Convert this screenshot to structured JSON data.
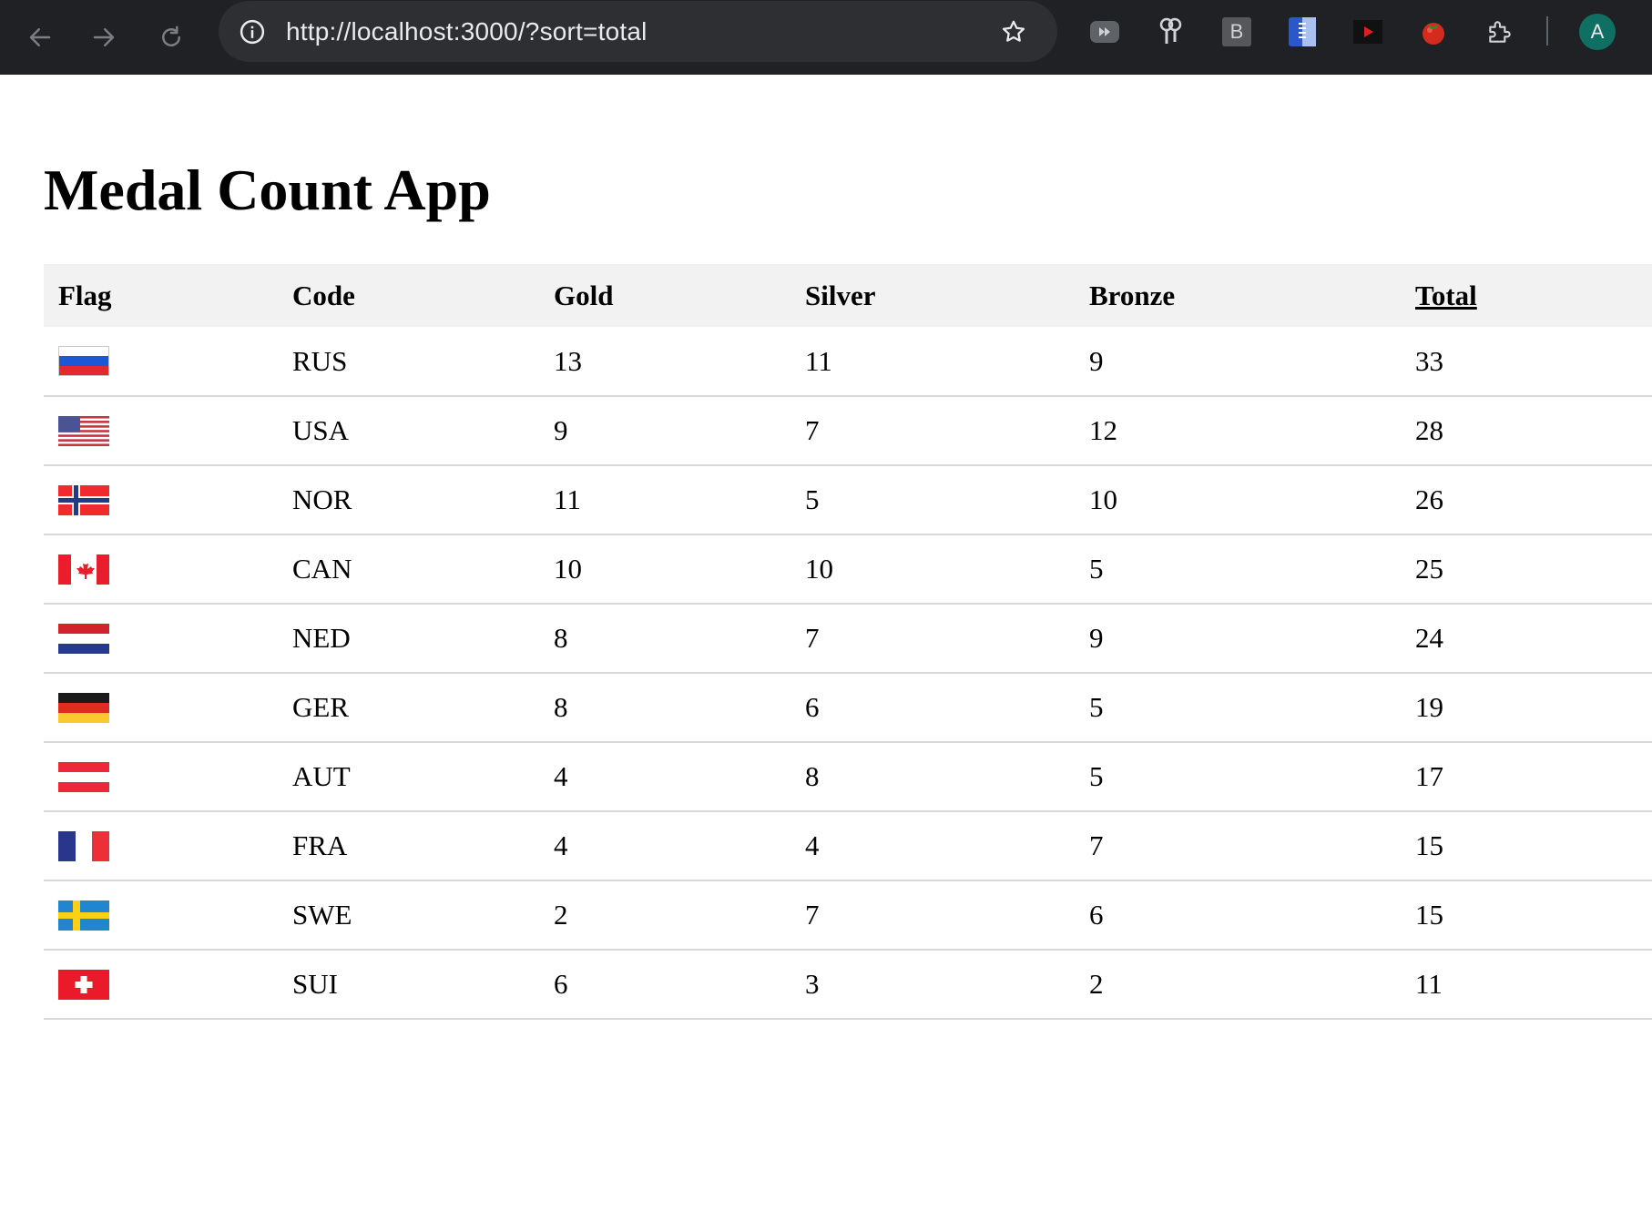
{
  "browser": {
    "url": "http://localhost:3000/?sort=total",
    "extension_letter": "B",
    "profile_initial": "A"
  },
  "page": {
    "title": "Medal Count App"
  },
  "table": {
    "headers": {
      "flag": "Flag",
      "code": "Code",
      "gold": "Gold",
      "silver": "Silver",
      "bronze": "Bronze",
      "total": "Total"
    },
    "sorted_by": "total",
    "rows": [
      {
        "code": "RUS",
        "gold": "13",
        "silver": "11",
        "bronze": "9",
        "total": "33",
        "flag": "russia-flag-icon"
      },
      {
        "code": "USA",
        "gold": "9",
        "silver": "7",
        "bronze": "12",
        "total": "28",
        "flag": "usa-flag-icon"
      },
      {
        "code": "NOR",
        "gold": "11",
        "silver": "5",
        "bronze": "10",
        "total": "26",
        "flag": "norway-flag-icon"
      },
      {
        "code": "CAN",
        "gold": "10",
        "silver": "10",
        "bronze": "5",
        "total": "25",
        "flag": "canada-flag-icon"
      },
      {
        "code": "NED",
        "gold": "8",
        "silver": "7",
        "bronze": "9",
        "total": "24",
        "flag": "netherlands-flag-icon"
      },
      {
        "code": "GER",
        "gold": "8",
        "silver": "6",
        "bronze": "5",
        "total": "19",
        "flag": "germany-flag-icon"
      },
      {
        "code": "AUT",
        "gold": "4",
        "silver": "8",
        "bronze": "5",
        "total": "17",
        "flag": "austria-flag-icon"
      },
      {
        "code": "FRA",
        "gold": "4",
        "silver": "4",
        "bronze": "7",
        "total": "15",
        "flag": "france-flag-icon"
      },
      {
        "code": "SWE",
        "gold": "2",
        "silver": "7",
        "bronze": "6",
        "total": "15",
        "flag": "sweden-flag-icon"
      },
      {
        "code": "SUI",
        "gold": "6",
        "silver": "3",
        "bronze": "2",
        "total": "11",
        "flag": "switzerland-flag-icon"
      }
    ]
  },
  "colors": {
    "chrome_bg": "#202124",
    "omnibox_bg": "#2e2f32",
    "header_row_bg": "#f2f2f2",
    "row_divider": "#d8d8d8",
    "avatar_bg": "#0e6f62"
  }
}
